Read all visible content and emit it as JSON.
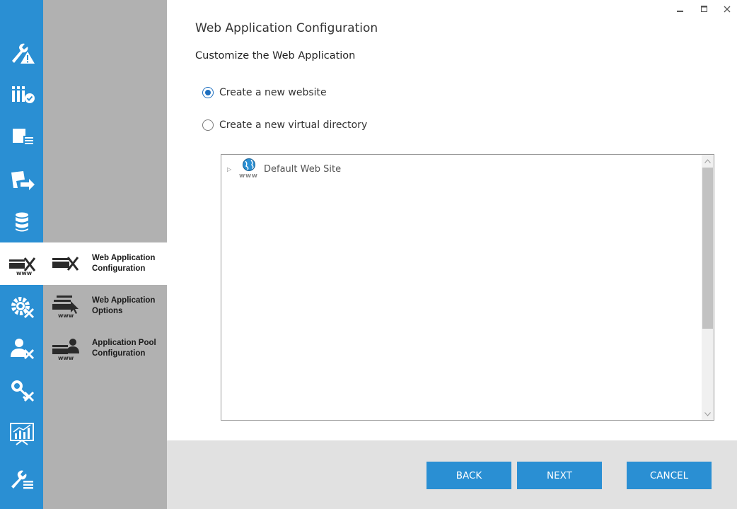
{
  "window": {
    "minimize_icon": "minimize-icon",
    "maximize_icon": "maximize-icon",
    "close_icon": "close-icon"
  },
  "rail": {
    "items": [
      {
        "icon": "wrench-warning-icon"
      },
      {
        "icon": "requirements-check-icon"
      },
      {
        "icon": "window-list-icon"
      },
      {
        "icon": "migrate-arrow-icon"
      },
      {
        "icon": "database-icon"
      },
      {
        "icon": "web-application-config-icon",
        "active": true
      },
      {
        "icon": "gear-tools-icon"
      },
      {
        "icon": "user-tools-icon"
      },
      {
        "icon": "key-tools-icon"
      },
      {
        "icon": "chart-presentation-icon"
      },
      {
        "icon": "wrench-list-icon"
      }
    ]
  },
  "steps": [
    {
      "label": "Web Application Configuration",
      "icon": "web-config-tools-icon",
      "active": true
    },
    {
      "label": "Web Application Options",
      "icon": "web-options-cursor-icon",
      "active": false
    },
    {
      "label": "Application Pool Configuration",
      "icon": "app-pool-user-icon",
      "active": false
    }
  ],
  "page": {
    "title": "Web Application Configuration",
    "section_title": "Customize the Web Application"
  },
  "options": {
    "new_website": {
      "label": "Create a new website",
      "checked": true
    },
    "virtual_directory": {
      "label": "Create a new virtual directory",
      "checked": false
    }
  },
  "tree": {
    "nodes": [
      {
        "label": "Default Web Site",
        "icon": "globe-www-icon",
        "icon_text": "www",
        "expander": "▷"
      }
    ]
  },
  "footer": {
    "back_label": "BACK",
    "next_label": "NEXT",
    "cancel_label": "CANCEL"
  },
  "colors": {
    "accent": "#2a8fd3",
    "step_panel": "#b1b1b1",
    "footer": "#e1e1e1"
  }
}
